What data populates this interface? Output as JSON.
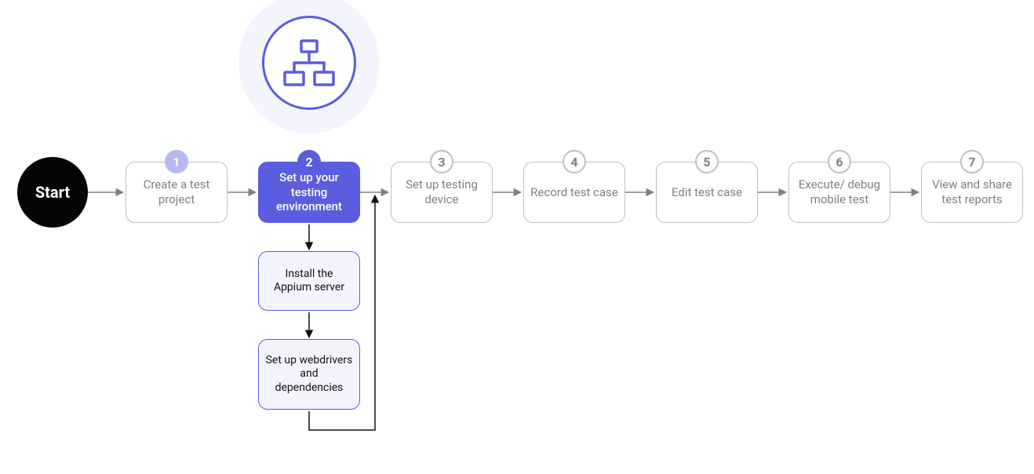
{
  "colors": {
    "primary": "#5C5CE0",
    "primary_light": "#B8B8F2",
    "primary_bg": "#F4F4FE",
    "muted_border": "#bfbfbf",
    "muted_text": "#808080",
    "start_bg": "#050505"
  },
  "hero_icon": "network-tree-icon",
  "start": {
    "label": "Start"
  },
  "steps": [
    {
      "num": "1",
      "label": "Create a test project",
      "state": "preactive"
    },
    {
      "num": "2",
      "label": "Set up your testing environment",
      "state": "active"
    },
    {
      "num": "3",
      "label": "Set up testing device",
      "state": "inactive"
    },
    {
      "num": "4",
      "label": "Record test case",
      "state": "inactive"
    },
    {
      "num": "5",
      "label": "Edit test case",
      "state": "inactive"
    },
    {
      "num": "6",
      "label": "Execute/ debug mobile test",
      "state": "inactive"
    },
    {
      "num": "7",
      "label": "View and share test reports",
      "state": "inactive"
    }
  ],
  "substeps": [
    {
      "label": "Install the Appium server"
    },
    {
      "label": "Set up webdrivers and dependencies"
    }
  ]
}
